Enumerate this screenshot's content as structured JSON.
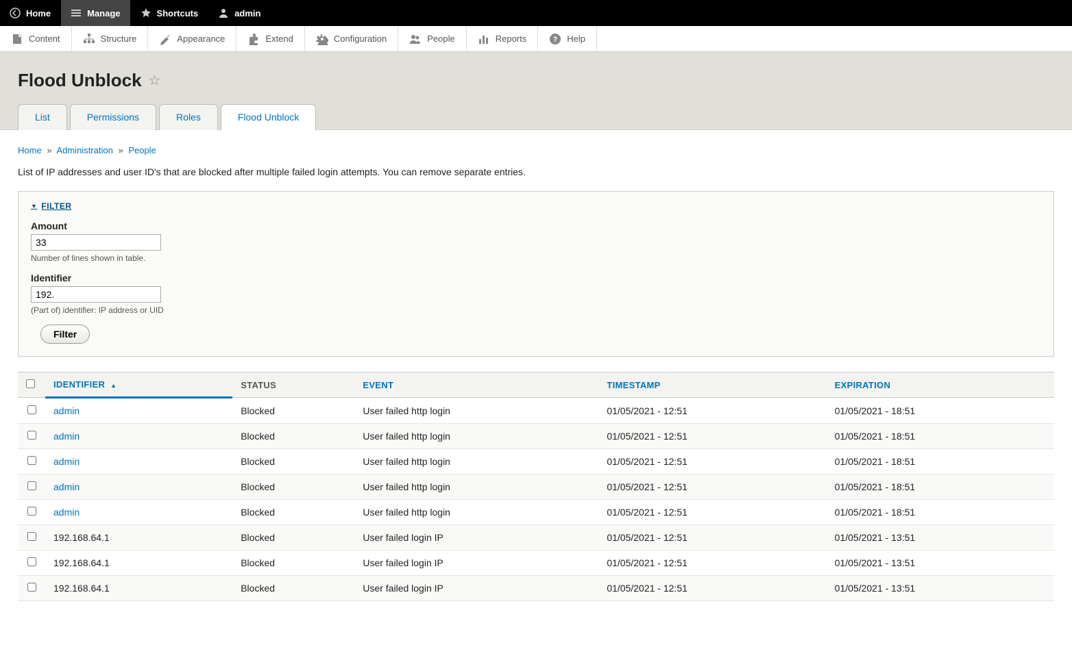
{
  "toolbar": {
    "home": "Home",
    "manage": "Manage",
    "shortcuts": "Shortcuts",
    "user": "admin"
  },
  "admin_menu": {
    "content": "Content",
    "structure": "Structure",
    "appearance": "Appearance",
    "extend": "Extend",
    "configuration": "Configuration",
    "people": "People",
    "reports": "Reports",
    "help": "Help"
  },
  "page": {
    "title": "Flood Unblock"
  },
  "tabs": {
    "list": "List",
    "permissions": "Permissions",
    "roles": "Roles",
    "flood_unblock": "Flood Unblock"
  },
  "breadcrumb": {
    "home": "Home",
    "administration": "Administration",
    "people": "People",
    "sep": "»"
  },
  "description": "List of IP addresses and user ID's that are blocked after multiple failed login attempts. You can remove separate entries.",
  "filter": {
    "legend": "FILTER",
    "amount_label": "Amount",
    "amount_value": "33",
    "amount_desc": "Number of lines shown in table.",
    "identifier_label": "Identifier",
    "identifier_value": "192.",
    "identifier_desc": "(Part of) identifier: IP address or UID",
    "button": "Filter"
  },
  "table": {
    "headers": {
      "identifier": "IDENTIFIER",
      "status": "STATUS",
      "event": "EVENT",
      "timestamp": "TIMESTAMP",
      "expiration": "EXPIRATION"
    },
    "rows": [
      {
        "identifier": "admin",
        "is_link": true,
        "status": "Blocked",
        "event": "User failed http login",
        "timestamp": "01/05/2021 - 12:51",
        "expiration": "01/05/2021 - 18:51"
      },
      {
        "identifier": "admin",
        "is_link": true,
        "status": "Blocked",
        "event": "User failed http login",
        "timestamp": "01/05/2021 - 12:51",
        "expiration": "01/05/2021 - 18:51"
      },
      {
        "identifier": "admin",
        "is_link": true,
        "status": "Blocked",
        "event": "User failed http login",
        "timestamp": "01/05/2021 - 12:51",
        "expiration": "01/05/2021 - 18:51"
      },
      {
        "identifier": "admin",
        "is_link": true,
        "status": "Blocked",
        "event": "User failed http login",
        "timestamp": "01/05/2021 - 12:51",
        "expiration": "01/05/2021 - 18:51"
      },
      {
        "identifier": "admin",
        "is_link": true,
        "status": "Blocked",
        "event": "User failed http login",
        "timestamp": "01/05/2021 - 12:51",
        "expiration": "01/05/2021 - 18:51"
      },
      {
        "identifier": "192.168.64.1",
        "is_link": false,
        "status": "Blocked",
        "event": "User failed login IP",
        "timestamp": "01/05/2021 - 12:51",
        "expiration": "01/05/2021 - 13:51"
      },
      {
        "identifier": "192.168.64.1",
        "is_link": false,
        "status": "Blocked",
        "event": "User failed login IP",
        "timestamp": "01/05/2021 - 12:51",
        "expiration": "01/05/2021 - 13:51"
      },
      {
        "identifier": "192.168.64.1",
        "is_link": false,
        "status": "Blocked",
        "event": "User failed login IP",
        "timestamp": "01/05/2021 - 12:51",
        "expiration": "01/05/2021 - 13:51"
      }
    ]
  }
}
